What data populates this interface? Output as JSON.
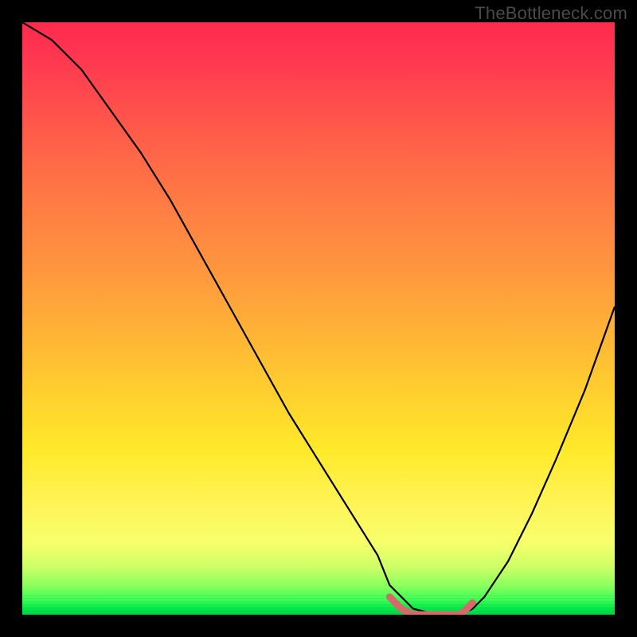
{
  "watermark": "TheBottleneck.com",
  "chart_data": {
    "type": "line",
    "title": "",
    "xlabel": "",
    "ylabel": "",
    "xlim": [
      0,
      100
    ],
    "ylim": [
      0,
      100
    ],
    "series": [
      {
        "name": "bottleneck-curve",
        "x": [
          0,
          5,
          10,
          15,
          20,
          25,
          30,
          35,
          40,
          45,
          50,
          55,
          60,
          62,
          66,
          70,
          74,
          76,
          78,
          82,
          86,
          90,
          95,
          100
        ],
        "values": [
          100,
          97,
          92,
          85,
          78,
          70,
          61,
          52,
          43,
          34,
          26,
          18,
          10,
          5,
          1,
          0,
          0,
          1,
          3,
          9,
          17,
          26,
          38,
          52
        ]
      }
    ],
    "highlight": {
      "name": "optimal-range",
      "color": "#d46a6a",
      "x": [
        62,
        64,
        66,
        70,
        74,
        76
      ],
      "values": [
        3,
        1,
        0,
        0,
        0,
        2
      ]
    },
    "gradient_stops": [
      {
        "pos": 0,
        "color": "#ff2a4d"
      },
      {
        "pos": 0.3,
        "color": "#ff7a44"
      },
      {
        "pos": 0.62,
        "color": "#ffce2f"
      },
      {
        "pos": 0.88,
        "color": "#f6ff6b"
      },
      {
        "pos": 1.0,
        "color": "#00d346"
      }
    ]
  }
}
